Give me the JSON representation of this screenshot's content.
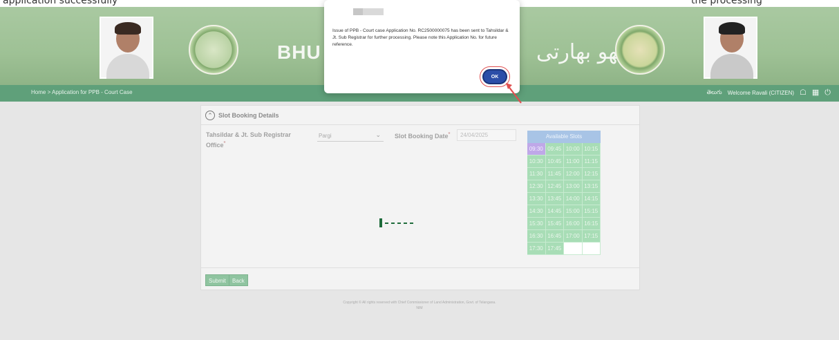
{
  "top_strip": {
    "left_text": "application successfully",
    "right_text": "the processing"
  },
  "banner": {
    "title": "BHU BI",
    "urdu_title": "بھو بھارتی",
    "left_portrait": "person-photo",
    "right_portrait": "person-photo"
  },
  "navbar": {
    "breadcrumb": "Home > Application for PPB - Court Case",
    "telugu": "తెలుగు",
    "welcome": "Welcome  Ravali (CITIZEN)"
  },
  "card": {
    "title": "Slot Booking Details",
    "office_label": "Tahsildar & Jt. Sub Registrar Office",
    "required_mark": "*",
    "office_value": "Pargi",
    "date_label": "Slot Booking Date",
    "date_value": "24/04/2025",
    "slots_header": "Available Slots",
    "slots": [
      "09:30",
      "09:45",
      "10:00",
      "10:15",
      "10:30",
      "10:45",
      "11:00",
      "11:15",
      "11:30",
      "11:45",
      "12:00",
      "12:15",
      "12:30",
      "12:45",
      "13:00",
      "13:15",
      "13:30",
      "13:45",
      "14:00",
      "14:15",
      "14:30",
      "14:45",
      "15:00",
      "15:15",
      "15:30",
      "15:45",
      "16:00",
      "16:15",
      "16:30",
      "16:45",
      "17:00",
      "17:15",
      "17:30",
      "17:45"
    ],
    "selected_slot": "09:30",
    "submit_label": "Submit",
    "back_label": "Back"
  },
  "footer": {
    "copyright": "Copyright © All rights reserved with Chief Commissioner of Land Administration, Govt. of Telangana.",
    "sub": "NIM"
  },
  "dialog": {
    "message": "Issue of PPB - Court case Application No. RC2500000075 has been sent to Tahsildar & Jt. Sub Registrar for further processing. Please note this Application No. for future reference.",
    "ok_label": "OK"
  },
  "colors": {
    "navbar": "#5fa07a",
    "slot_available": "#a8ddb6",
    "slot_selected": "#bfa8e8",
    "ok_button": "#2c4ea8",
    "annotation": "#e05050"
  }
}
